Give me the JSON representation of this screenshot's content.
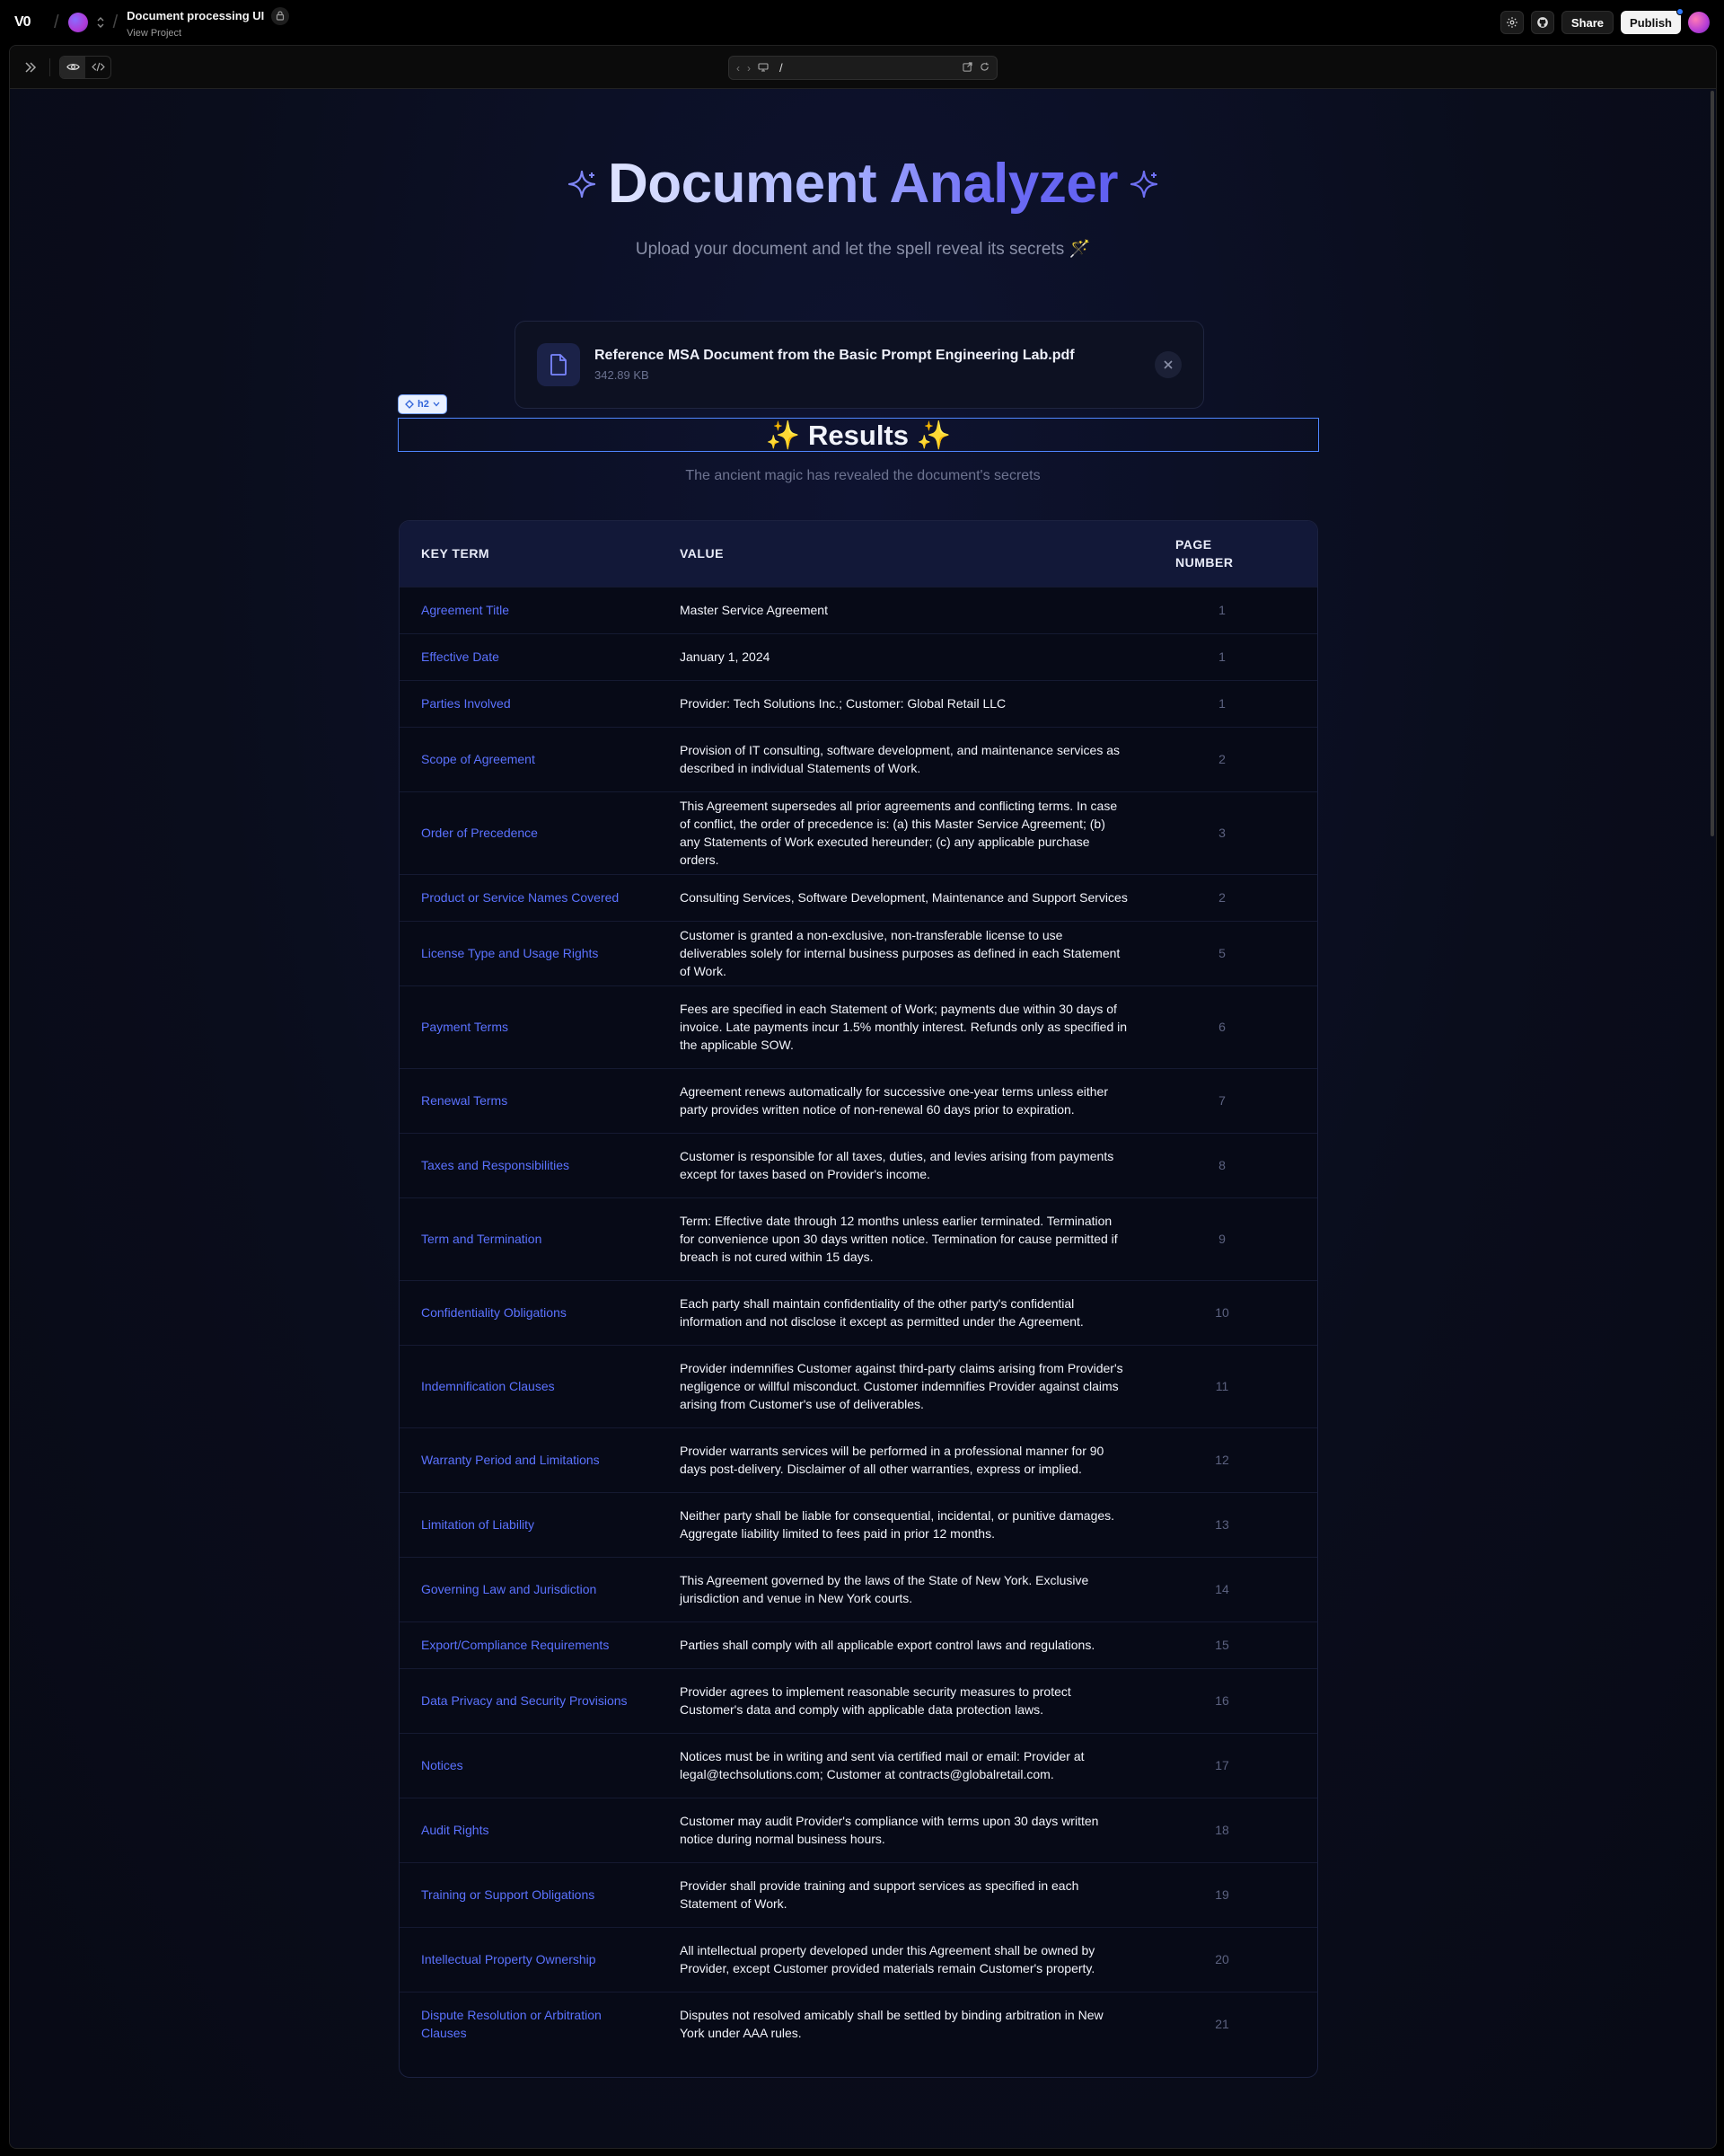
{
  "topbar": {
    "logo": "V0",
    "project_title": "Document processing UI",
    "project_link": "View Project",
    "share_label": "Share",
    "publish_label": "Publish"
  },
  "preview": {
    "url_path": "/"
  },
  "app": {
    "title": "Document Analyzer",
    "subtitle": "Upload your document and let the spell reveal its secrets 🪄",
    "file": {
      "name": "Reference MSA Document from the Basic Prompt Engineering Lab.pdf",
      "size": "342.89 KB"
    },
    "element_tag": "h2",
    "results_title": "✨ Results ✨",
    "results_subtitle": "The ancient magic has revealed the document's secrets",
    "table": {
      "headers": {
        "term": "KEY TERM",
        "value": "VALUE",
        "page_line1": "PAGE",
        "page_line2": "NUMBER"
      },
      "rows": [
        {
          "term": "Agreement Title",
          "value": "Master Service Agreement",
          "page": "1"
        },
        {
          "term": "Effective Date",
          "value": "January 1, 2024",
          "page": "1"
        },
        {
          "term": "Parties Involved",
          "value": "Provider: Tech Solutions Inc.; Customer: Global Retail LLC",
          "page": "1"
        },
        {
          "term": "Scope of Agreement",
          "value": "Provision of IT consulting, software development, and maintenance services as described in individual Statements of Work.",
          "page": "2"
        },
        {
          "term": "Order of Precedence",
          "value": "This Agreement supersedes all prior agreements and conflicting terms. In case of conflict, the order of precedence is: (a) this Master Service Agreement; (b) any Statements of Work executed hereunder; (c) any applicable purchase orders.",
          "page": "3"
        },
        {
          "term": "Product or Service Names Covered",
          "value": "Consulting Services, Software Development, Maintenance and Support Services",
          "page": "2"
        },
        {
          "term": "License Type and Usage Rights",
          "value": "Customer is granted a non-exclusive, non-transferable license to use deliverables solely for internal business purposes as defined in each Statement of Work.",
          "page": "5"
        },
        {
          "term": "Payment Terms",
          "value": "Fees are specified in each Statement of Work; payments due within 30 days of invoice. Late payments incur 1.5% monthly interest. Refunds only as specified in the applicable SOW.",
          "page": "6"
        },
        {
          "term": "Renewal Terms",
          "value": "Agreement renews automatically for successive one-year terms unless either party provides written notice of non-renewal 60 days prior to expiration.",
          "page": "7"
        },
        {
          "term": "Taxes and Responsibilities",
          "value": "Customer is responsible for all taxes, duties, and levies arising from payments except for taxes based on Provider's income.",
          "page": "8"
        },
        {
          "term": "Term and Termination",
          "value": "Term: Effective date through 12 months unless earlier terminated. Termination for convenience upon 30 days written notice. Termination for cause permitted if breach is not cured within 15 days.",
          "page": "9"
        },
        {
          "term": "Confidentiality Obligations",
          "value": "Each party shall maintain confidentiality of the other party's confidential information and not disclose it except as permitted under the Agreement.",
          "page": "10"
        },
        {
          "term": "Indemnification Clauses",
          "value": "Provider indemnifies Customer against third-party claims arising from Provider's negligence or willful misconduct. Customer indemnifies Provider against claims arising from Customer's use of deliverables.",
          "page": "11"
        },
        {
          "term": "Warranty Period and Limitations",
          "value": "Provider warrants services will be performed in a professional manner for 90 days post-delivery. Disclaimer of all other warranties, express or implied.",
          "page": "12"
        },
        {
          "term": "Limitation of Liability",
          "value": "Neither party shall be liable for consequential, incidental, or punitive damages. Aggregate liability limited to fees paid in prior 12 months.",
          "page": "13"
        },
        {
          "term": "Governing Law and Jurisdiction",
          "value": "This Agreement governed by the laws of the State of New York. Exclusive jurisdiction and venue in New York courts.",
          "page": "14"
        },
        {
          "term": "Export/Compliance Requirements",
          "value": "Parties shall comply with all applicable export control laws and regulations.",
          "page": "15"
        },
        {
          "term": "Data Privacy and Security Provisions",
          "value": "Provider agrees to implement reasonable security measures to protect Customer's data and comply with applicable data protection laws.",
          "page": "16"
        },
        {
          "term": "Notices",
          "value": "Notices must be in writing and sent via certified mail or email: Provider at legal@techsolutions.com; Customer at contracts@globalretail.com.",
          "page": "17"
        },
        {
          "term": "Audit Rights",
          "value": "Customer may audit Provider's compliance with terms upon 30 days written notice during normal business hours.",
          "page": "18"
        },
        {
          "term": "Training or Support Obligations",
          "value": "Provider shall provide training and support services as specified in each Statement of Work.",
          "page": "19"
        },
        {
          "term": "Intellectual Property Ownership",
          "value": "All intellectual property developed under this Agreement shall be owned by Provider, except Customer provided materials remain Customer's property.",
          "page": "20"
        },
        {
          "term": "Dispute Resolution or Arbitration Clauses",
          "value": "Disputes not resolved amicably shall be settled by binding arbitration in New York under AAA rules.",
          "page": "21"
        }
      ]
    }
  },
  "colors": {
    "accent": "#5b72ff",
    "background": "#0a0d1a",
    "selection": "#4f86ff"
  }
}
